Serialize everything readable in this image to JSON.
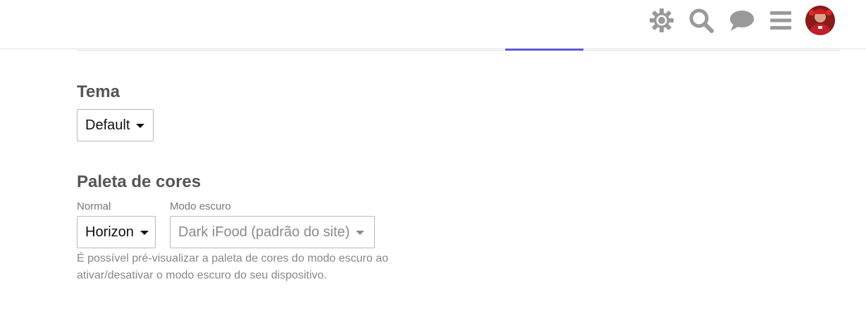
{
  "header": {
    "icons": [
      "gear-icon",
      "search-icon",
      "chat-icon",
      "hamburger-menu-icon"
    ],
    "avatar": "user-avatar"
  },
  "theme": {
    "title": "Tema",
    "selected": "Default"
  },
  "palette": {
    "title": "Paleta de cores",
    "normal_label": "Normal",
    "normal_selected": "Horizon",
    "dark_label": "Modo escuro",
    "dark_selected": "Dark iFood (padrão do site)",
    "help_text": "É possível pré-visualizar a paleta de cores do modo escuro ao ativar/desativar o modo escuro do seu dispositivo."
  },
  "colors": {
    "accent": "#5b5bd6",
    "icon_gray": "#9a9a9a",
    "title_gray": "#555555"
  }
}
